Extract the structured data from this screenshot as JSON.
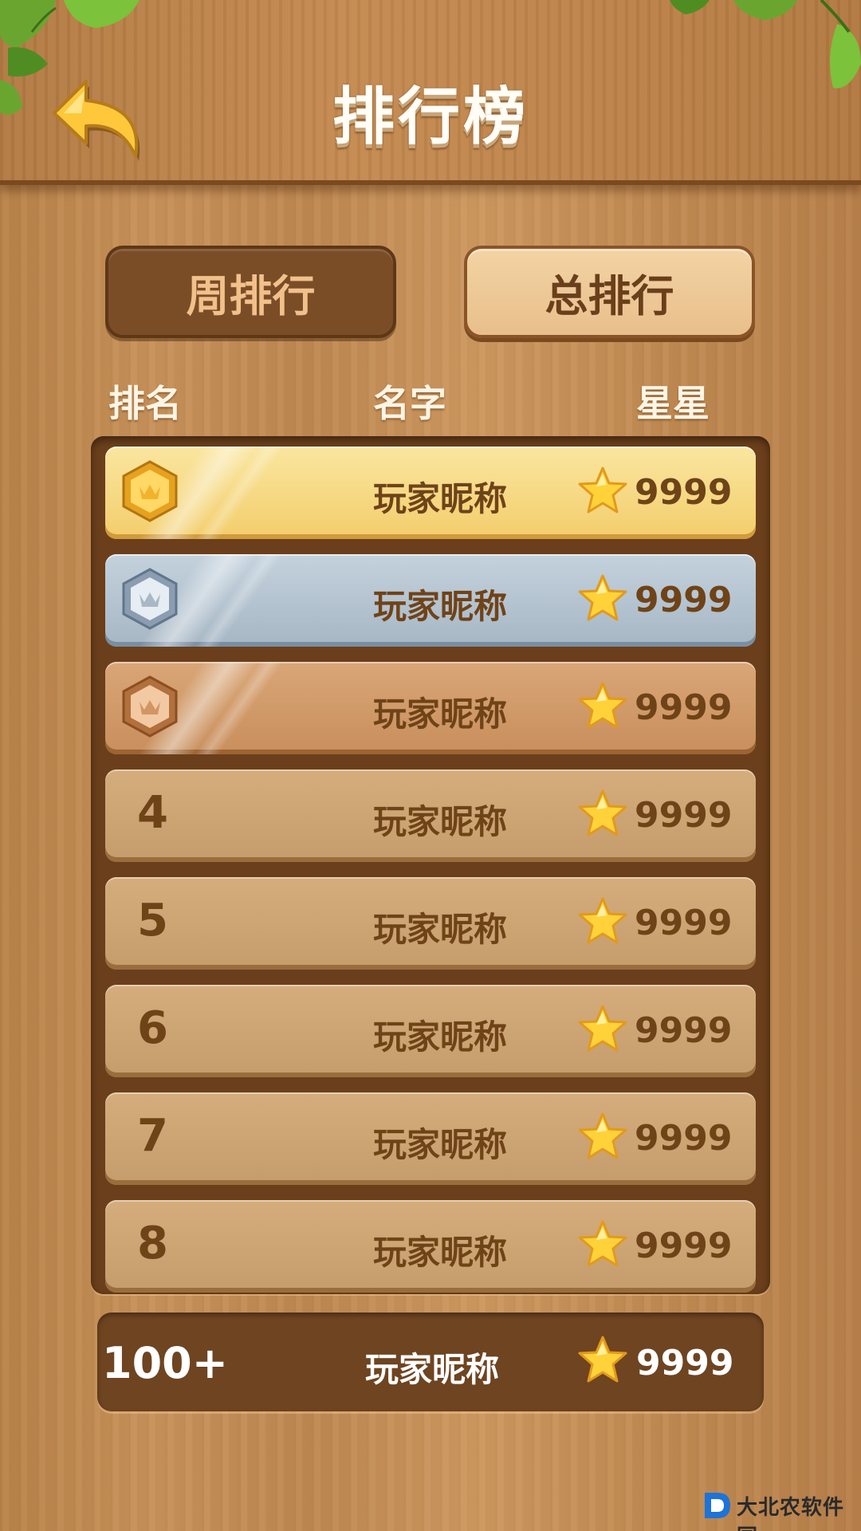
{
  "header": {
    "title": "排行榜",
    "back_icon": "back-arrow-icon"
  },
  "tabs": [
    {
      "label": "周排行",
      "active": true
    },
    {
      "label": "总排行",
      "active": false
    }
  ],
  "columns": {
    "rank": "排名",
    "name": "名字",
    "stars": "星星"
  },
  "entries": [
    {
      "rank": "1",
      "medal": "gold",
      "name": "玩家昵称",
      "stars": "9999"
    },
    {
      "rank": "2",
      "medal": "silver",
      "name": "玩家昵称",
      "stars": "9999"
    },
    {
      "rank": "3",
      "medal": "bronze",
      "name": "玩家昵称",
      "stars": "9999"
    },
    {
      "rank": "4",
      "name": "玩家昵称",
      "stars": "9999"
    },
    {
      "rank": "5",
      "name": "玩家昵称",
      "stars": "9999"
    },
    {
      "rank": "6",
      "name": "玩家昵称",
      "stars": "9999"
    },
    {
      "rank": "7",
      "name": "玩家昵称",
      "stars": "9999"
    },
    {
      "rank": "8",
      "name": "玩家昵称",
      "stars": "9999"
    }
  ],
  "self_entry": {
    "rank": "100+",
    "name": "玩家昵称",
    "stars": "9999"
  },
  "colors": {
    "gold_row": "#f6da84",
    "silver_row": "#b3c1ce",
    "bronze_row": "#cf9865",
    "plain_row": "#cda475",
    "text_brown": "#6f4318",
    "accent_star": "#ffd23a"
  },
  "watermark": {
    "text": "大北农软件园"
  }
}
